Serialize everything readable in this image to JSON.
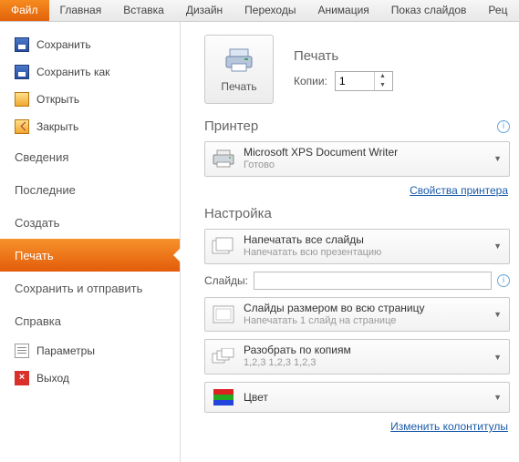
{
  "ribbon": {
    "tabs": [
      "Файл",
      "Главная",
      "Вставка",
      "Дизайн",
      "Переходы",
      "Анимация",
      "Показ слайдов",
      "Рец"
    ]
  },
  "sidebar": {
    "top": [
      {
        "label": "Сохранить",
        "icon": "save"
      },
      {
        "label": "Сохранить как",
        "icon": "save"
      },
      {
        "label": "Открыть",
        "icon": "open"
      },
      {
        "label": "Закрыть",
        "icon": "close"
      }
    ],
    "mid": [
      "Сведения",
      "Последние",
      "Создать",
      "Печать",
      "Сохранить и отправить",
      "Справка"
    ],
    "bot": [
      {
        "label": "Параметры",
        "icon": "param"
      },
      {
        "label": "Выход",
        "icon": "exit"
      }
    ],
    "active": "Печать"
  },
  "print": {
    "header": "Печать",
    "button": "Печать",
    "copies_label": "Копии:",
    "copies_value": "1"
  },
  "printer": {
    "header": "Принтер",
    "name": "Microsoft XPS Document Writer",
    "status": "Готово",
    "props_link": "Свойства принтера"
  },
  "settings": {
    "header": "Настройка",
    "range": {
      "t1": "Напечатать все слайды",
      "t2": "Напечатать всю презентацию"
    },
    "slides_label": "Слайды:",
    "slides_value": "",
    "layout": {
      "t1": "Слайды размером во всю страницу",
      "t2": "Напечатать 1 слайд на странице"
    },
    "collate": {
      "t1": "Разобрать по копиям",
      "t2": "1,2,3    1,2,3    1,2,3"
    },
    "color": {
      "t1": "Цвет"
    },
    "footer_link": "Изменить колонтитулы"
  }
}
